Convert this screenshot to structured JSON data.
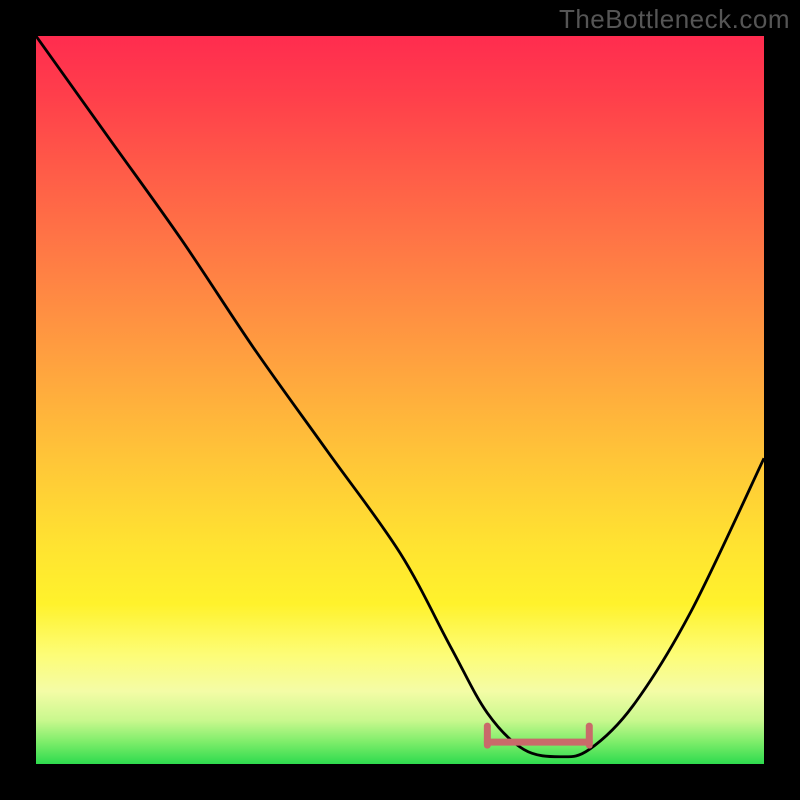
{
  "watermark": "TheBottleneck.com",
  "chart_data": {
    "type": "line",
    "title": "",
    "xlabel": "",
    "ylabel": "",
    "xlim": [
      0,
      100
    ],
    "ylim": [
      0,
      100
    ],
    "series": [
      {
        "name": "bottleneck-curve",
        "x": [
          0,
          10,
          20,
          30,
          40,
          50,
          57,
          62,
          67,
          72,
          76,
          82,
          90,
          100
        ],
        "y": [
          100,
          86,
          72,
          57,
          43,
          29,
          16,
          7,
          2,
          1,
          2,
          8,
          21,
          42
        ]
      }
    ],
    "annotations": [
      {
        "name": "optimal-range",
        "x_start": 62,
        "x_end": 76,
        "y": 3
      }
    ],
    "colors": {
      "curve": "#000000",
      "optimal_marker": "#c96a6a",
      "gradient_top": "#ff2c4f",
      "gradient_bottom": "#2edb4e"
    }
  }
}
